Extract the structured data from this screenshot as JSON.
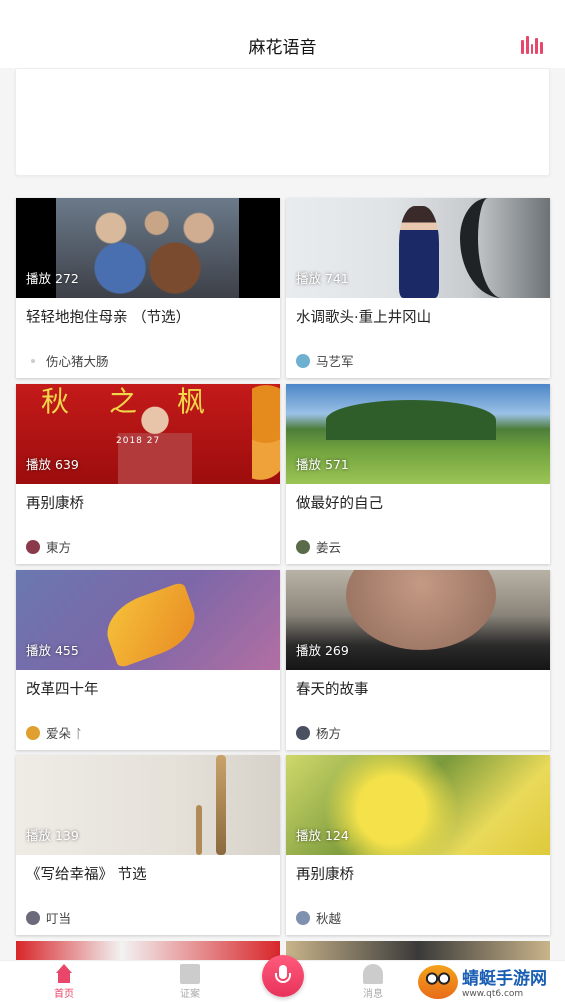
{
  "header": {
    "title": "麻花语音"
  },
  "cards": [
    {
      "plays": "播放 272",
      "title": "轻轻地抱住母亲 （节选）",
      "author": "伤心猪大肠"
    },
    {
      "plays": "播放 741",
      "title": "水调歌头·重上井冈山",
      "author": "马艺军"
    },
    {
      "plays": "播放 639",
      "title": "再别康桥",
      "author": "東方"
    },
    {
      "plays": "播放 571",
      "title": "做最好的自己",
      "author": "姜云"
    },
    {
      "plays": "播放 455",
      "title": "改革四十年",
      "author": "爱朵 ᛚ"
    },
    {
      "plays": "播放 269",
      "title": "春天的故事",
      "author": "杨方"
    },
    {
      "plays": "播放 139",
      "title": "《写给幸福》 节选",
      "author": "叮当"
    },
    {
      "plays": "播放 124",
      "title": "再别康桥",
      "author": "秋越"
    }
  ],
  "thumb_art": {
    "card3_letters": "秋之枫",
    "card3_numbers": "2018 27"
  },
  "tabs": [
    {
      "label": "首页",
      "icon": "home-icon",
      "active": true
    },
    {
      "label": "证案",
      "icon": "book-icon",
      "active": false
    },
    {
      "label": "",
      "icon": "mic-icon",
      "active": false
    },
    {
      "label": "消息",
      "icon": "bell-icon",
      "active": false
    }
  ],
  "watermark": {
    "title": "蜻蜓手游网",
    "url": "www.qt6.com"
  },
  "colors": {
    "accent": "#e8476a",
    "background": "#f5f5f5"
  }
}
